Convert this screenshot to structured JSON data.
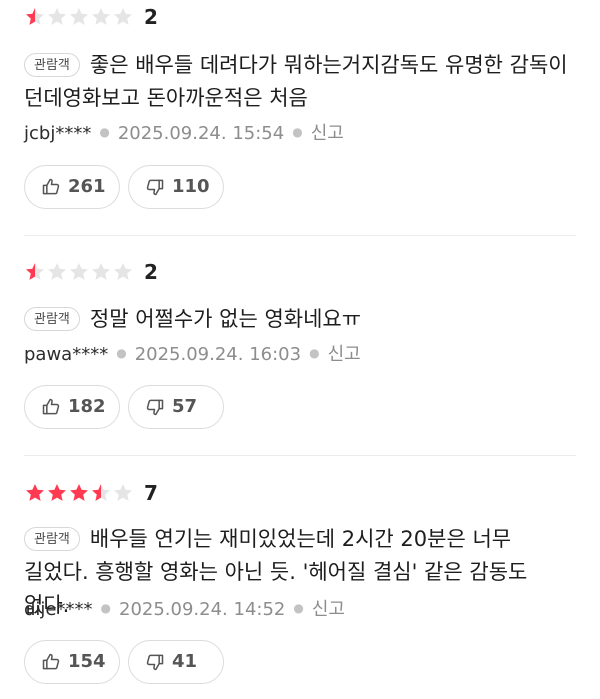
{
  "colors": {
    "star_filled": "#ff3a52",
    "star_empty": "#e5e5e5",
    "divider": "#ececec"
  },
  "reviews": [
    {
      "rating_stars": 0.5,
      "score": "2",
      "badge": "관람객",
      "text": "좋은 배우들 데려다가 뭐하는거지감독도 유명한 감독이 던데영화보고 돈아까운적은 처음",
      "user": "jcbj****",
      "date": "2025.09.24. 15:54",
      "report": "신고",
      "likes": "261",
      "dislikes": "110",
      "like_icon": "thumbs-up-icon",
      "dislike_icon": "thumbs-down-icon"
    },
    {
      "rating_stars": 0.5,
      "score": "2",
      "badge": "관람객",
      "text": "정말 어쩔수가 없는 영화네요ㅠ",
      "user": "pawa****",
      "date": "2025.09.24. 16:03",
      "report": "신고",
      "likes": "182",
      "dislikes": "57",
      "like_icon": "thumbs-up-icon",
      "dislike_icon": "thumbs-down-icon"
    },
    {
      "rating_stars": 3.5,
      "score": "7",
      "badge": "관람객",
      "text": "배우들 연기는 재미있었는데 2시간 20분은 너무 길었다. 흥행할 영화는 아닌 듯. '헤어질 결심' 같은 감동도 없다.",
      "user": "dije****",
      "date": "2025.09.24. 14:52",
      "report": "신고",
      "likes": "154",
      "dislikes": "41",
      "like_icon": "thumbs-up-icon",
      "dislike_icon": "thumbs-down-icon"
    }
  ]
}
